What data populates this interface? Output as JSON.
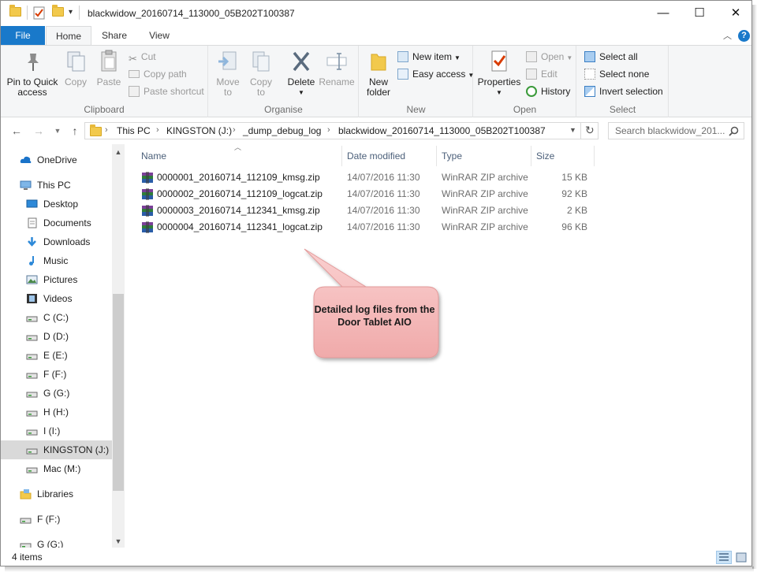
{
  "window": {
    "title": "blackwidow_20160714_113000_05B202T100387",
    "controls": {
      "minimize": "—",
      "maximize": "☐",
      "close": "✕"
    }
  },
  "ribbon_tabs": {
    "file": "File",
    "home": "Home",
    "share": "Share",
    "view": "View"
  },
  "ribbon": {
    "clipboard": {
      "label": "Clipboard",
      "pin": "Pin to Quick\naccess",
      "copy": "Copy",
      "paste": "Paste",
      "cut": "Cut",
      "copy_path": "Copy path",
      "paste_shortcut": "Paste shortcut"
    },
    "organise": {
      "label": "Organise",
      "move_to": "Move\nto",
      "copy_to": "Copy\nto",
      "delete": "Delete",
      "rename": "Rename"
    },
    "new": {
      "label": "New",
      "new_folder": "New\nfolder",
      "new_item": "New item",
      "easy_access": "Easy access"
    },
    "open": {
      "label": "Open",
      "properties": "Properties",
      "open": "Open",
      "edit": "Edit",
      "history": "History"
    },
    "select": {
      "label": "Select",
      "select_all": "Select all",
      "select_none": "Select none",
      "invert": "Invert selection"
    }
  },
  "address": {
    "crumbs": [
      "This PC",
      "KINGSTON (J:)",
      "_dump_debug_log",
      "blackwidow_20160714_113000_05B202T100387"
    ],
    "search_placeholder": "Search blackwidow_201..."
  },
  "nav_pane": {
    "items": [
      {
        "label": "OneDrive",
        "icon": "cloud-icon"
      },
      {
        "label": "This PC",
        "icon": "computer-icon"
      },
      {
        "label": "Desktop",
        "icon": "desktop-icon"
      },
      {
        "label": "Documents",
        "icon": "documents-icon"
      },
      {
        "label": "Downloads",
        "icon": "downloads-icon"
      },
      {
        "label": "Music",
        "icon": "music-icon"
      },
      {
        "label": "Pictures",
        "icon": "pictures-icon"
      },
      {
        "label": "Videos",
        "icon": "videos-icon"
      },
      {
        "label": "C (C:)",
        "icon": "drive-icon"
      },
      {
        "label": "D (D:)",
        "icon": "drive-icon"
      },
      {
        "label": "E (E:)",
        "icon": "drive-icon"
      },
      {
        "label": "F (F:)",
        "icon": "drive-icon"
      },
      {
        "label": "G (G:)",
        "icon": "drive-icon"
      },
      {
        "label": "H (H:)",
        "icon": "drive-icon"
      },
      {
        "label": "I (I:)",
        "icon": "drive-icon"
      },
      {
        "label": "KINGSTON (J:)",
        "icon": "drive-icon"
      },
      {
        "label": "Mac (M:)",
        "icon": "drive-icon"
      },
      {
        "label": "Libraries",
        "icon": "libraries-icon"
      },
      {
        "label": "F (F:)",
        "icon": "drive-icon"
      },
      {
        "label": "G (G:)",
        "icon": "drive-icon"
      }
    ]
  },
  "columns": {
    "name": "Name",
    "date": "Date modified",
    "type": "Type",
    "size": "Size"
  },
  "files": [
    {
      "name": "0000001_20160714_112109_kmsg.zip",
      "date": "14/07/2016 11:30",
      "type": "WinRAR ZIP archive",
      "size": "15 KB"
    },
    {
      "name": "0000002_20160714_112109_logcat.zip",
      "date": "14/07/2016 11:30",
      "type": "WinRAR ZIP archive",
      "size": "92 KB"
    },
    {
      "name": "0000003_20160714_112341_kmsg.zip",
      "date": "14/07/2016 11:30",
      "type": "WinRAR ZIP archive",
      "size": "2 KB"
    },
    {
      "name": "0000004_20160714_112341_logcat.zip",
      "date": "14/07/2016 11:30",
      "type": "WinRAR ZIP archive",
      "size": "96 KB"
    }
  ],
  "status": {
    "count": "4 items"
  },
  "callout": {
    "text": "Detailed log files from the Door Tablet AIO"
  },
  "colors": {
    "accent": "#1979ca",
    "callout_fill": "#f4b6b6",
    "callout_stroke": "#e8a0a0",
    "selected": "#d9d9d9"
  }
}
